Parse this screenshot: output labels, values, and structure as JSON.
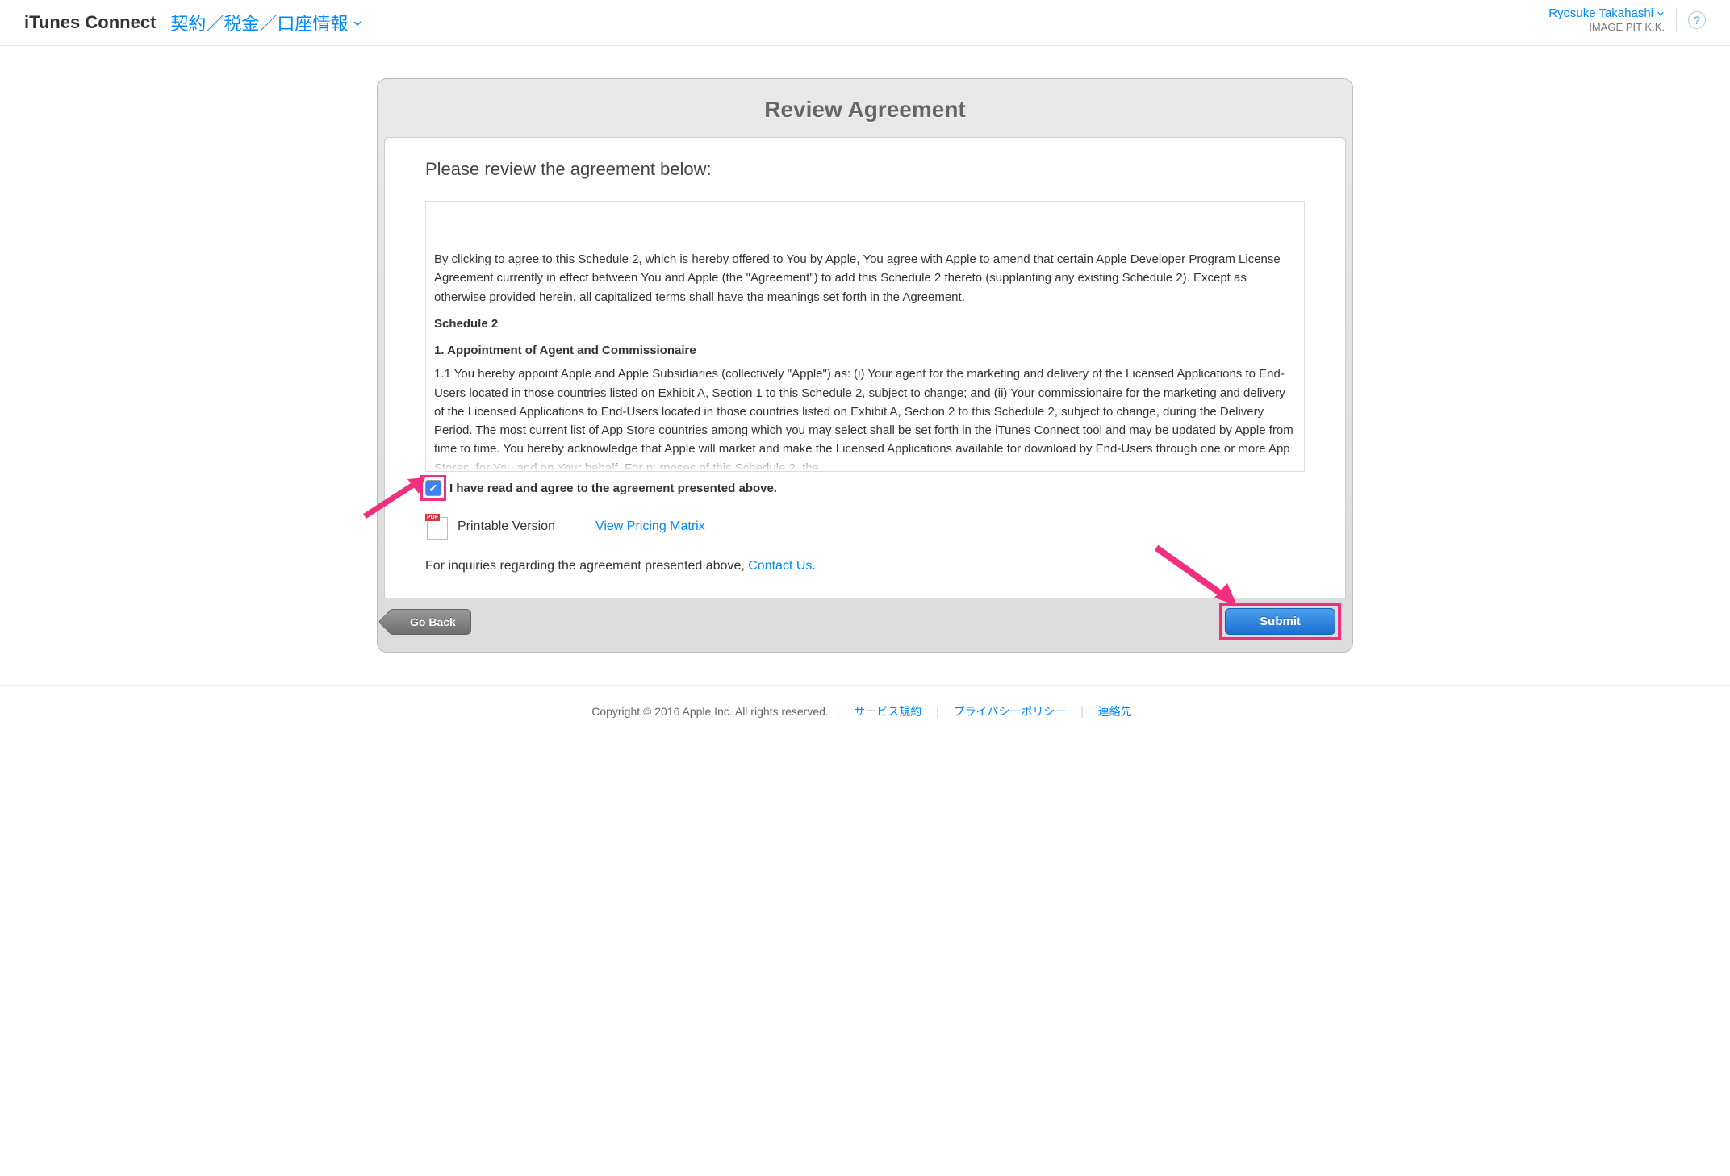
{
  "header": {
    "brand": "iTunes Connect",
    "section": "契約／税金／口座情報",
    "user_name": "Ryosuke Takahashi",
    "company": "IMAGE PIT K.K."
  },
  "panel": {
    "title": "Review Agreement",
    "instruction": "Please review the agreement below:",
    "agreement": {
      "intro": "By clicking to agree to this Schedule 2, which is hereby offered to You by Apple, You agree with Apple to amend that certain Apple Developer Program License Agreement currently in effect between You and Apple (the \"Agreement\") to add this Schedule 2 thereto (supplanting any existing Schedule 2). Except as otherwise provided herein, all capitalized terms shall have the meanings set forth in the Agreement.",
      "heading1": "Schedule 2",
      "heading2": "1. Appointment of Agent and Commissionaire",
      "para11": "1.1 You hereby appoint Apple and Apple Subsidiaries (collectively \"Apple\") as: (i) Your agent for the marketing and delivery of the Licensed Applications to End-Users located in those countries listed on Exhibit A, Section 1 to this Schedule 2, subject to change; and (ii) Your commissionaire for the marketing and delivery of the Licensed Applications to End-Users located in those countries listed on Exhibit A, Section 2 to this Schedule 2, subject to change, during the Delivery Period. The most current list of App Store countries among which you may select shall be set forth in the iTunes Connect tool and may be updated by Apple from time to time. You hereby acknowledge that Apple will market and make the Licensed Applications available for download by End-Users through one or more App Stores, for You and on Your behalf. For purposes of this Schedule 2, the"
    },
    "checkbox_label": "I have read and agree to the agreement presented above.",
    "checkbox_checked": true,
    "printable_label": "Printable Version",
    "pricing_link": "View Pricing Matrix",
    "inquiry_prefix": "For inquiries regarding the agreement presented above, ",
    "contact_link": "Contact Us",
    "inquiry_suffix": ".",
    "back_label": "Go Back",
    "submit_label": "Submit"
  },
  "footer": {
    "copyright": "Copyright © 2016 Apple Inc. All rights reserved.",
    "links": [
      "サービス規約",
      "プライバシーポリシー",
      "連絡先"
    ]
  }
}
